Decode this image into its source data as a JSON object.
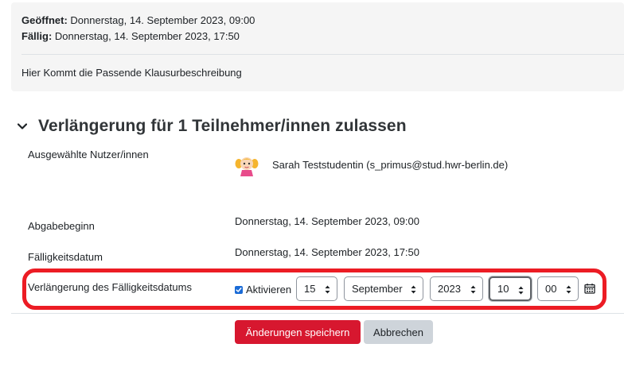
{
  "info": {
    "opened_label": "Geöffnet:",
    "opened_value": "Donnerstag, 14. September 2023, 09:00",
    "due_label": "Fällig:",
    "due_value": "Donnerstag, 14. September 2023, 17:50",
    "description": "Hier Kommt die Passende Klausurbeschreibung"
  },
  "section": {
    "title": "Verlängerung für 1 Teilnehmer/innen zulassen"
  },
  "form": {
    "selected_users_label": "Ausgewählte Nutzer/innen",
    "user_name": "Sarah Teststudentin (s_primus@stud.hwr-berlin.de)",
    "start_label": "Abgabebeginn",
    "start_value": "Donnerstag, 14. September 2023, 09:00",
    "due_label": "Fälligkeitsdatum",
    "due_value": "Donnerstag, 14. September 2023, 17:50",
    "extension_label": "Verlängerung des Fälligkeitsdatums",
    "enable_label": "Aktivieren",
    "enable_checked": true,
    "day": "15",
    "month": "September",
    "year": "2023",
    "hour": "10",
    "minute": "00"
  },
  "buttons": {
    "save": "Änderungen speichern",
    "cancel": "Abbrechen"
  },
  "colors": {
    "primary": "#d7172f",
    "highlight": "#ec1c24",
    "checkbox": "#1a6bd6"
  }
}
